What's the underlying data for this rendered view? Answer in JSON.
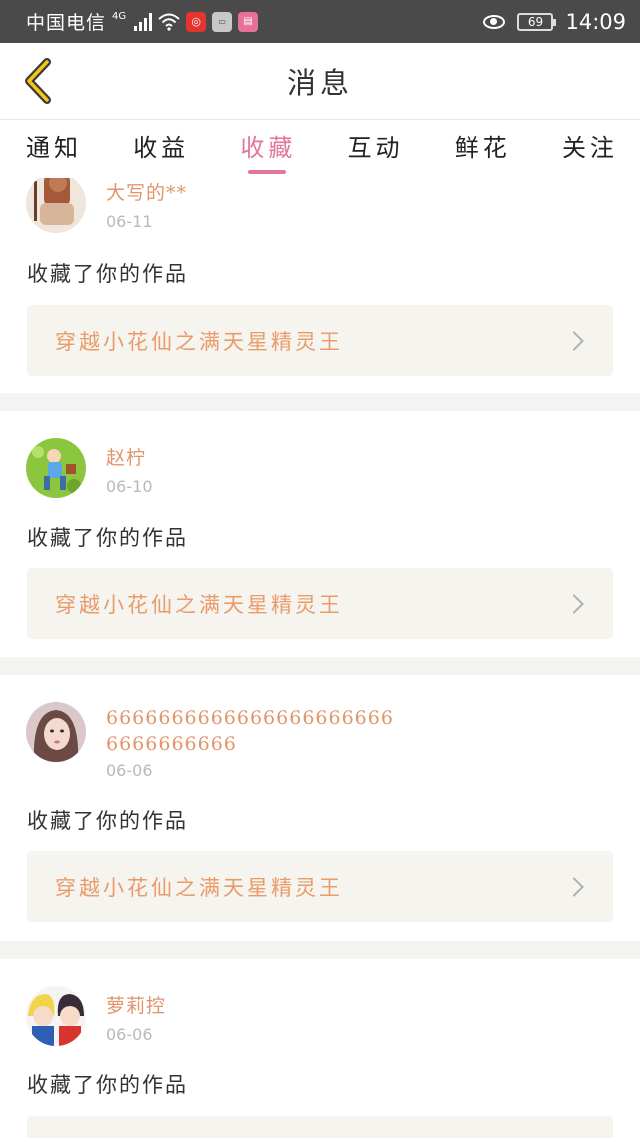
{
  "status_bar": {
    "carrier": "中国电信",
    "network": "4G",
    "battery": "69",
    "time": "14:09"
  },
  "header": {
    "title": "消息",
    "back_icon": "chevron-left-icon"
  },
  "tabs": [
    {
      "label": "通知",
      "active": false
    },
    {
      "label": "收益",
      "active": false
    },
    {
      "label": "收藏",
      "active": true
    },
    {
      "label": "互动",
      "active": false
    },
    {
      "label": "鲜花",
      "active": false
    },
    {
      "label": "关注",
      "active": false
    }
  ],
  "colors": {
    "accent": "#e2769b",
    "name_color": "#e2956b",
    "work_title_color": "#ea9b6a",
    "status_bar": "#4a4a4a"
  },
  "messages": [
    {
      "name": "大写的**",
      "date": "06-11",
      "action": "收藏了你的作品",
      "work": "穿越小花仙之满天星精灵王"
    },
    {
      "name": "赵柠",
      "date": "06-10",
      "action": "收藏了你的作品",
      "work": "穿越小花仙之满天星精灵王"
    },
    {
      "name": "66666666666666666666666666666666",
      "date": "06-06",
      "action": "收藏了你的作品",
      "work": "穿越小花仙之满天星精灵王"
    },
    {
      "name": "萝莉控",
      "date": "06-06",
      "action": "收藏了你的作品",
      "work": ""
    }
  ]
}
